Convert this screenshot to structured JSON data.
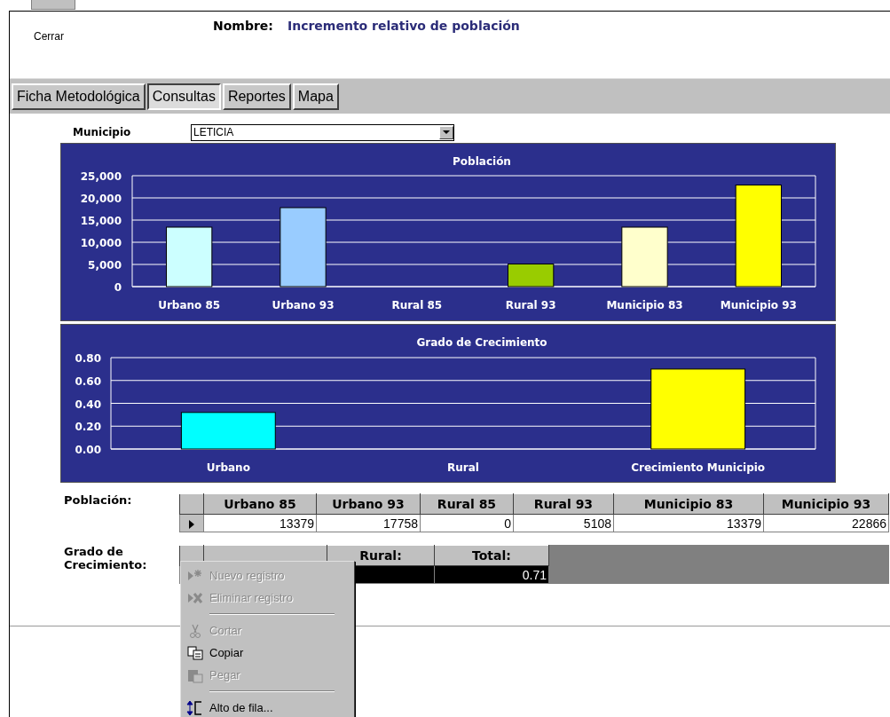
{
  "header": {
    "close_label": "Cerrar",
    "name_label": "Nombre:",
    "name_value": "Incremento relativo de población"
  },
  "tabs": [
    {
      "label": "Ficha Metodológica",
      "selected": false
    },
    {
      "label": "Consultas",
      "selected": true
    },
    {
      "label": "Reportes",
      "selected": false
    },
    {
      "label": "Mapa",
      "selected": false
    }
  ],
  "municipio": {
    "label": "Municipio",
    "value": "LETICIA"
  },
  "charts": [
    {
      "chart_data": {
        "type": "bar",
        "title": "Población",
        "categories": [
          "Urbano 85",
          "Urbano 93",
          "Rural 85",
          "Rural 93",
          "Municipio 83",
          "Municipio 93"
        ],
        "values": [
          13400,
          17800,
          0,
          5100,
          13400,
          22900
        ],
        "colors": [
          "#ccffff",
          "#99ccff",
          null,
          "#99cc00",
          "#ffffcc",
          "#ffff00"
        ],
        "grid": true,
        "ylim": [
          0,
          25000
        ],
        "yticks": [
          {
            "value": 0,
            "label": "0"
          },
          {
            "value": 5000,
            "label": "5,000"
          },
          {
            "value": 10000,
            "label": "10,000"
          },
          {
            "value": 15000,
            "label": "15,000"
          },
          {
            "value": 20000,
            "label": "20,000"
          },
          {
            "value": 25000,
            "label": "25,000"
          }
        ]
      }
    },
    {
      "chart_data": {
        "type": "bar",
        "title": "Grado de Crecimiento",
        "categories": [
          "Urbano",
          "Rural",
          "Crecimiento Municipio"
        ],
        "values": [
          0.32,
          0,
          0.7
        ],
        "colors": [
          "#00ffff",
          null,
          "#ffff00"
        ],
        "grid": true,
        "ylim": [
          0,
          0.8
        ],
        "yticks": [
          {
            "value": 0,
            "label": "0.00"
          },
          {
            "value": 0.2,
            "label": "0.20"
          },
          {
            "value": 0.4,
            "label": "0.40"
          },
          {
            "value": 0.6,
            "label": "0.60"
          },
          {
            "value": 0.8,
            "label": "0.80"
          }
        ]
      }
    }
  ],
  "poblacion_table": {
    "label": "Población:",
    "columns": [
      "Urbano 85",
      "Urbano 93",
      "Rural 85",
      "Rural 93",
      "Municipio 83",
      "Municipio 93"
    ],
    "rows": [
      {
        "selected": false,
        "cells": [
          "13379",
          "17758",
          "0",
          "5108",
          "13379",
          "22866"
        ]
      }
    ]
  },
  "crecimiento_table": {
    "label": "Grado de\nCrecimiento:",
    "columns": [
      "",
      "Rural:",
      "Total:"
    ],
    "rows": [
      {
        "selected": true,
        "cells": [
          "",
          "",
          "0.71"
        ]
      }
    ]
  },
  "context_menu": {
    "items": [
      {
        "kind": "new",
        "label": "Nuevo registro",
        "disabled": true
      },
      {
        "kind": "delete",
        "label": "Eliminar registro",
        "disabled": true
      },
      {
        "kind": "separator"
      },
      {
        "kind": "cut",
        "label": "Cortar",
        "disabled": true
      },
      {
        "kind": "copy",
        "label": "Copiar",
        "disabled": false
      },
      {
        "kind": "paste",
        "label": "Pegar",
        "disabled": true
      },
      {
        "kind": "separator"
      },
      {
        "kind": "rowheight",
        "label": "Alto de fila...",
        "disabled": false
      }
    ]
  }
}
